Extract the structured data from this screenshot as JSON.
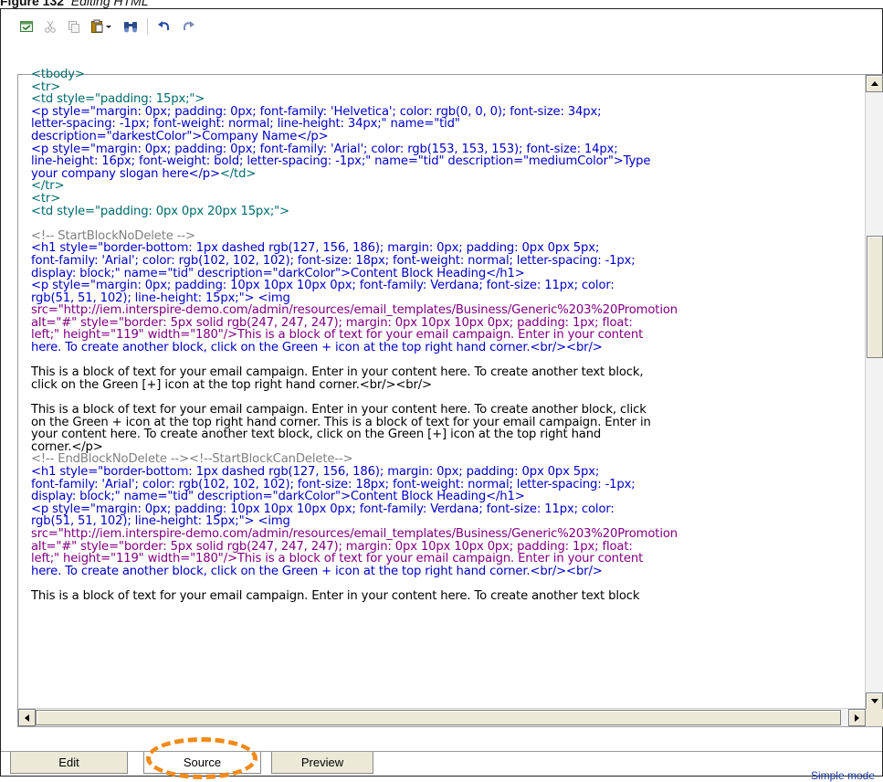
{
  "caption": {
    "figure": "Figure 132",
    "text": "Editing HTML"
  },
  "toolbar": {
    "icons": [
      "source-toggle-icon",
      "cut-icon",
      "copy-icon",
      "paste-icon",
      "find-icon",
      "undo-icon",
      "redo-icon"
    ]
  },
  "editor": {
    "lines": [
      {
        "t": "tag",
        "s": "<tbody>"
      },
      {
        "t": "tag",
        "s": "<tr>"
      },
      {
        "t": "tag",
        "s": "<td style=\"padding: 15px;\">"
      },
      {
        "t": "code",
        "s": "<p style=\"margin: 0px; padding: 0px; font-family: 'Helvetica'; color: rgb(0, 0, 0); font-size: 34px;"
      },
      {
        "t": "code",
        "s": "letter-spacing: -1px; font-weight: normal; line-height: 34px;\" name=\"tid\""
      },
      {
        "t": "code",
        "s": "description=\"darkestColor\">Company Name</p>"
      },
      {
        "t": "code",
        "s": "<p style=\"margin: 0px; padding: 0px; font-family: 'Arial'; color: rgb(153, 153, 153); font-size: 14px;"
      },
      {
        "t": "code",
        "s": "line-height: 16px; font-weight: bold; letter-spacing: -1px;\" name=\"tid\" description=\"mediumColor\">Type"
      },
      {
        "t": "mixed",
        "s": "your company slogan here</p>",
        "s2": "</td>"
      },
      {
        "t": "tag",
        "s": "</tr>"
      },
      {
        "t": "tag",
        "s": "<tr>"
      },
      {
        "t": "tag",
        "s": "<td style=\"padding: 0px 0px 20px 15px;\">"
      },
      {
        "t": "gap",
        "s": ""
      },
      {
        "t": "cm",
        "s": "<!-- StartBlockNoDelete -->"
      },
      {
        "t": "code",
        "s": "<h1 style=\"border-bottom: 1px dashed rgb(127, 156, 186); margin: 0px; padding: 0px 0px 5px;"
      },
      {
        "t": "code",
        "s": "font-family: 'Arial'; color: rgb(102, 102, 102); font-size: 18px; font-weight: normal; letter-spacing: -1px;"
      },
      {
        "t": "code",
        "s": "display: block;\" name=\"tid\" description=\"darkColor\">Content Block Heading</h1>"
      },
      {
        "t": "code",
        "s": "<p style=\"margin: 0px; padding: 10px 10px 10px 0px; font-family: Verdana; font-size: 11px; color:"
      },
      {
        "t": "code",
        "s": "rgb(51, 51, 102); line-height: 15px;\"> <img"
      },
      {
        "t": "pur",
        "s": "src=\"http://iem.interspire-demo.com/admin/resources/email_templates/Business/Generic%203%20Promotion"
      },
      {
        "t": "pur",
        "s": "alt=\"#\" style=\"border: 5px solid rgb(247, 247, 247); margin: 0px 10px 10px 0px; padding: 1px; float:"
      },
      {
        "t": "pur",
        "s": "left;\" height=\"119\" width=\"180\"/>This is a block of text for your email campaign. Enter in your content"
      },
      {
        "t": "code",
        "s": "here. To create another block, click on the Green + icon at the top right hand corner.<br/><br/>"
      },
      {
        "t": "gap",
        "s": ""
      },
      {
        "t": "blk",
        "s": "This is a block of text for your email campaign. Enter in your content here. To create another text block,"
      },
      {
        "t": "blk",
        "s": "click on the Green [+] icon at the top right hand corner.<br/><br/>"
      },
      {
        "t": "gap",
        "s": ""
      },
      {
        "t": "blk",
        "s": "This is a block of text for your email campaign. Enter in your content here. To create another block, click"
      },
      {
        "t": "blk",
        "s": "on the Green + icon at the top right hand corner. This is a block of text for your email campaign. Enter in"
      },
      {
        "t": "blk",
        "s": "your content here. To create another text block, click on the Green [+] icon at the top right hand"
      },
      {
        "t": "blk",
        "s": "corner.</p>"
      },
      {
        "t": "cm",
        "s": "<!-- EndBlockNoDelete --><!--StartBlockCanDelete-->"
      },
      {
        "t": "code",
        "s": "<h1 style=\"border-bottom: 1px dashed rgb(127, 156, 186); margin: 0px; padding: 0px 0px 5px;"
      },
      {
        "t": "code",
        "s": "font-family: 'Arial'; color: rgb(102, 102, 102); font-size: 18px; font-weight: normal; letter-spacing: -1px;"
      },
      {
        "t": "code",
        "s": "display: block;\" name=\"tid\" description=\"darkColor\">Content Block Heading</h1>"
      },
      {
        "t": "code",
        "s": "<p style=\"margin: 0px; padding: 10px 10px 10px 0px; font-family: Verdana; font-size: 11px; color:"
      },
      {
        "t": "code",
        "s": "rgb(51, 51, 102); line-height: 15px;\"> <img"
      },
      {
        "t": "pur",
        "s": "src=\"http://iem.interspire-demo.com/admin/resources/email_templates/Business/Generic%203%20Promotion"
      },
      {
        "t": "pur",
        "s": "alt=\"#\" style=\"border: 5px solid rgb(247, 247, 247); margin: 0px 10px 10px 0px; padding: 1px; float:"
      },
      {
        "t": "pur",
        "s": "left;\" height=\"119\" width=\"180\"/>This is a block of text for your email campaign. Enter in your content"
      },
      {
        "t": "code",
        "s": "here. To create another block, click on the Green + icon at the top right hand corner.<br/><br/>"
      },
      {
        "t": "gap",
        "s": ""
      },
      {
        "t": "blk",
        "s": "This is a block of text for your email campaign. Enter in your content here. To create another text block"
      }
    ]
  },
  "tabs": [
    {
      "label": "Edit",
      "active": false
    },
    {
      "label": "Source",
      "active": true
    },
    {
      "label": "Preview",
      "active": false
    }
  ],
  "simple_mode_label": "Simple mode",
  "colors": {
    "highlight": "#f28a1a",
    "code": "#0000cc",
    "tag": "#006b6b",
    "comment": "#808080",
    "attr": "#800080"
  }
}
